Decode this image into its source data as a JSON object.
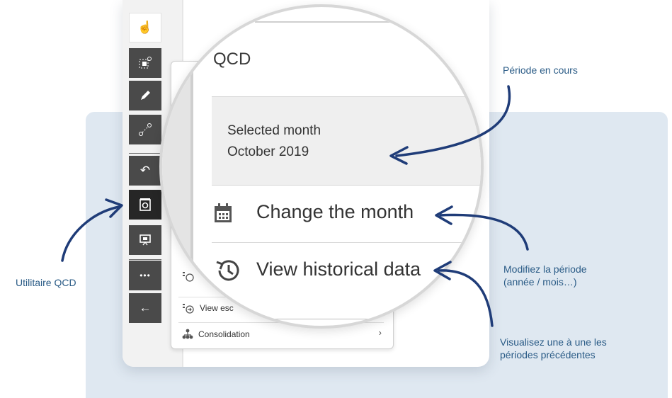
{
  "background_panel_color": "#dfe8f1",
  "annotation_color": "#2a5b86",
  "arrow_color": "#1f3c78",
  "toolbar": {
    "buttons": [
      {
        "name": "pointer-icon",
        "glyph": "☝"
      },
      {
        "name": "selection-icon",
        "glyph": "⬚"
      },
      {
        "name": "pencil-icon",
        "glyph": "✎"
      },
      {
        "name": "connector-icon",
        "glyph": "⟋"
      },
      {
        "name": "undo-icon",
        "glyph": "↶"
      },
      {
        "name": "qcd-utility-icon",
        "glyph": "⊡"
      },
      {
        "name": "presentation-icon",
        "glyph": "▣"
      },
      {
        "name": "more-icon",
        "glyph": "•••"
      },
      {
        "name": "back-arrow-icon",
        "glyph": "←"
      }
    ]
  },
  "menu": {
    "escalate_label": "View esc",
    "consolidation_label": "Consolidation",
    "chevron": "›"
  },
  "magnifier": {
    "title": "QCD",
    "selected_month_label": "Selected month",
    "selected_month_value": "October 2019",
    "change_month_label": "Change the month",
    "view_history_label": "View historical data"
  },
  "annotations": {
    "current_period": "Période en cours",
    "qcd_utility": "Utilitaire QCD",
    "modify_period_line1": "Modifiez la période",
    "modify_period_line2": "(année / mois…)",
    "previous_periods_line1": "Visualisez une à une les",
    "previous_periods_line2": "périodes précédentes"
  }
}
